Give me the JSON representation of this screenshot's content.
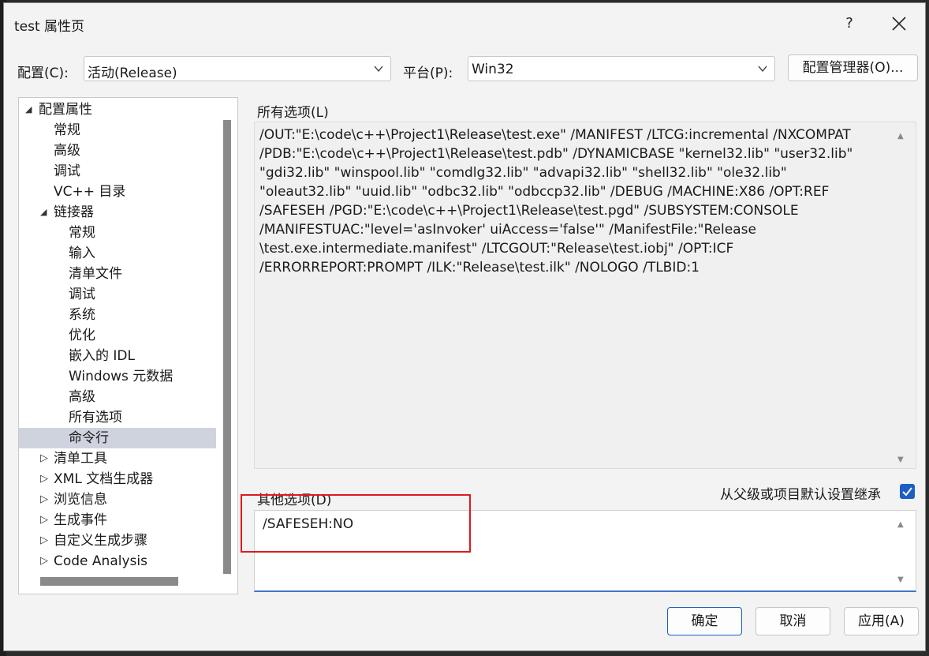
{
  "window": {
    "title": "test 属性页",
    "help": "?"
  },
  "config": {
    "label": "配置(C):",
    "value": "活动(Release)"
  },
  "platform": {
    "label": "平台(P):",
    "value": "Win32"
  },
  "config_manager_button": "配置管理器(O)...",
  "tree": {
    "items": [
      {
        "label": "配置属性",
        "expander": "expanded"
      },
      {
        "label": "常规"
      },
      {
        "label": "高级"
      },
      {
        "label": "调试"
      },
      {
        "label": "VC++ 目录"
      },
      {
        "label": "链接器",
        "expander": "expanded"
      },
      {
        "label": "常规"
      },
      {
        "label": "输入"
      },
      {
        "label": "清单文件"
      },
      {
        "label": "调试"
      },
      {
        "label": "系统"
      },
      {
        "label": "优化"
      },
      {
        "label": "嵌入的 IDL"
      },
      {
        "label": "Windows 元数据"
      },
      {
        "label": "高级"
      },
      {
        "label": "所有选项"
      },
      {
        "label": "命令行",
        "selected": true
      },
      {
        "label": "清单工具",
        "expander": "collapsed"
      },
      {
        "label": "XML 文档生成器",
        "expander": "collapsed"
      },
      {
        "label": "浏览信息",
        "expander": "collapsed"
      },
      {
        "label": "生成事件",
        "expander": "collapsed"
      },
      {
        "label": "自定义生成步骤",
        "expander": "collapsed"
      },
      {
        "label": "Code Analysis",
        "expander": "collapsed"
      }
    ]
  },
  "all_options": {
    "label": "所有选项(L)",
    "lines": [
      "/OUT:\"E:\\code\\c++\\Project1\\Release\\test.exe\" /MANIFEST /LTCG:incremental /NXCOMPAT",
      "/PDB:\"E:\\code\\c++\\Project1\\Release\\test.pdb\" /DYNAMICBASE \"kernel32.lib\" \"user32.lib\"",
      "\"gdi32.lib\" \"winspool.lib\" \"comdlg32.lib\" \"advapi32.lib\" \"shell32.lib\" \"ole32.lib\"",
      "\"oleaut32.lib\" \"uuid.lib\" \"odbc32.lib\" \"odbccp32.lib\" /DEBUG /MACHINE:X86 /OPT:REF",
      "/SAFESEH /PGD:\"E:\\code\\c++\\Project1\\Release\\test.pgd\" /SUBSYSTEM:CONSOLE",
      "/MANIFESTUAC:\"level='asInvoker' uiAccess='false'\" /ManifestFile:\"Release",
      "\\test.exe.intermediate.manifest\" /LTCGOUT:\"Release\\test.iobj\" /OPT:ICF",
      "/ERRORREPORT:PROMPT /ILK:\"Release\\test.ilk\" /NOLOGO /TLBID:1"
    ]
  },
  "other_options": {
    "label": "其他选项(D)",
    "value": "/SAFESEH:NO"
  },
  "inherit": {
    "label": "从父级或项目默认设置继承",
    "checked": true
  },
  "buttons": {
    "ok": "确定",
    "cancel": "取消",
    "apply": "应用(A)"
  },
  "colors": {
    "accent": "#1c5fc4",
    "highlight_box": "#e0191e",
    "selected_row": "#cfd3de"
  }
}
